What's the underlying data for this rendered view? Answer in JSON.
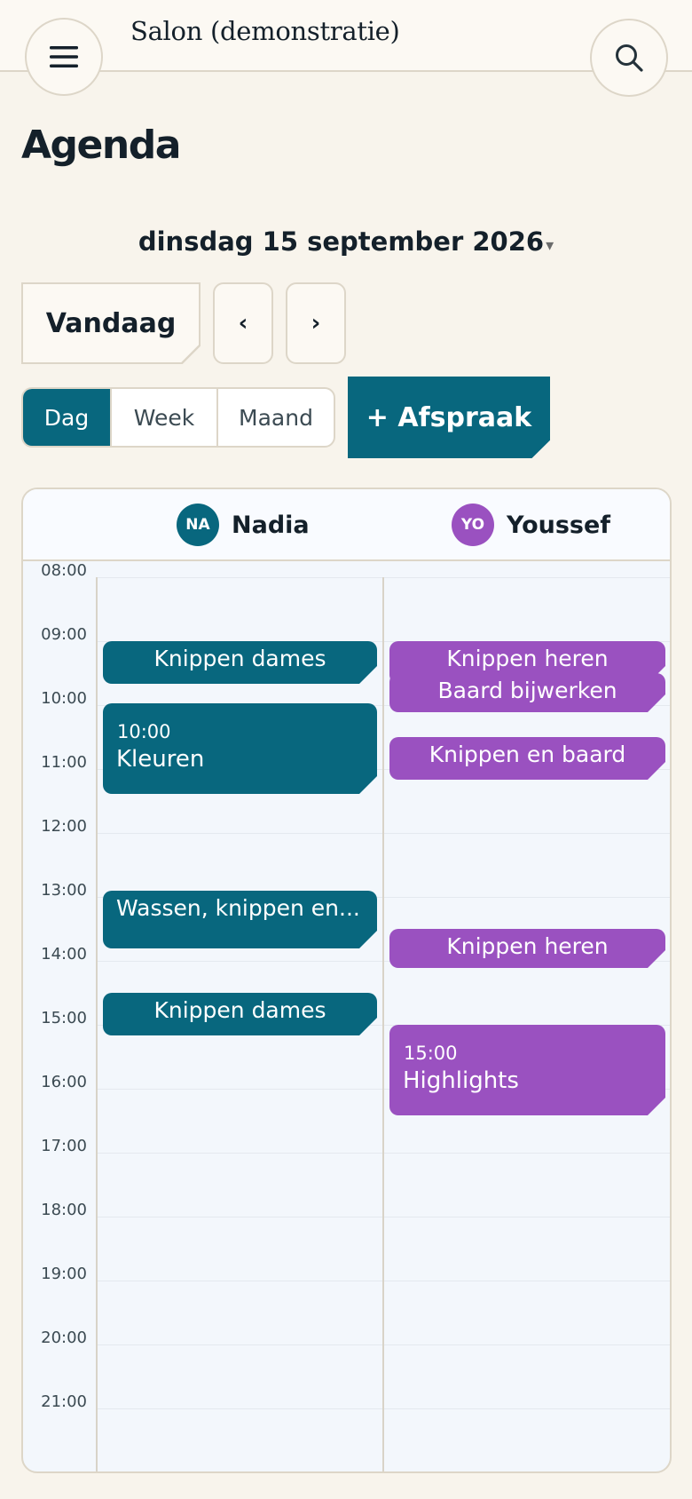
{
  "header": {
    "salon_name": "Salon (demonstratie)",
    "menu_icon": "hamburger-menu-icon",
    "search_icon": "search-icon"
  },
  "page": {
    "title": "Agenda"
  },
  "date_picker": {
    "label": "dinsdag 15 september 2026",
    "caret": "▾"
  },
  "toolbar": {
    "today_label": "Vandaag",
    "prev_label": "‹",
    "next_label": "›",
    "views": [
      {
        "label": "Dag",
        "active": true
      },
      {
        "label": "Week",
        "active": false
      },
      {
        "label": "Maand",
        "active": false
      }
    ],
    "add_label": "+ Afspraak"
  },
  "calendar": {
    "staff": [
      {
        "initials": "NA",
        "name": "Nadia",
        "color": "#08677e"
      },
      {
        "initials": "YO",
        "name": "Youssef",
        "color": "#9a51c0"
      }
    ],
    "hours": [
      "08:00",
      "09:00",
      "10:00",
      "11:00",
      "12:00",
      "13:00",
      "14:00",
      "15:00",
      "16:00",
      "17:00",
      "18:00",
      "19:00",
      "20:00",
      "21:00"
    ],
    "appointments": {
      "nadia": [
        {
          "title": "Knippen dames"
        },
        {
          "time": "10:00",
          "title": "Kleuren"
        },
        {
          "title": "Wassen, knippen en..."
        },
        {
          "title": "Knippen dames"
        }
      ],
      "youssef": [
        {
          "title": "Knippen heren"
        },
        {
          "title": "Baard bijwerken"
        },
        {
          "title": "Knippen en baard"
        },
        {
          "title": "Knippen heren"
        },
        {
          "time": "15:00",
          "title": "Highlights"
        }
      ]
    }
  }
}
